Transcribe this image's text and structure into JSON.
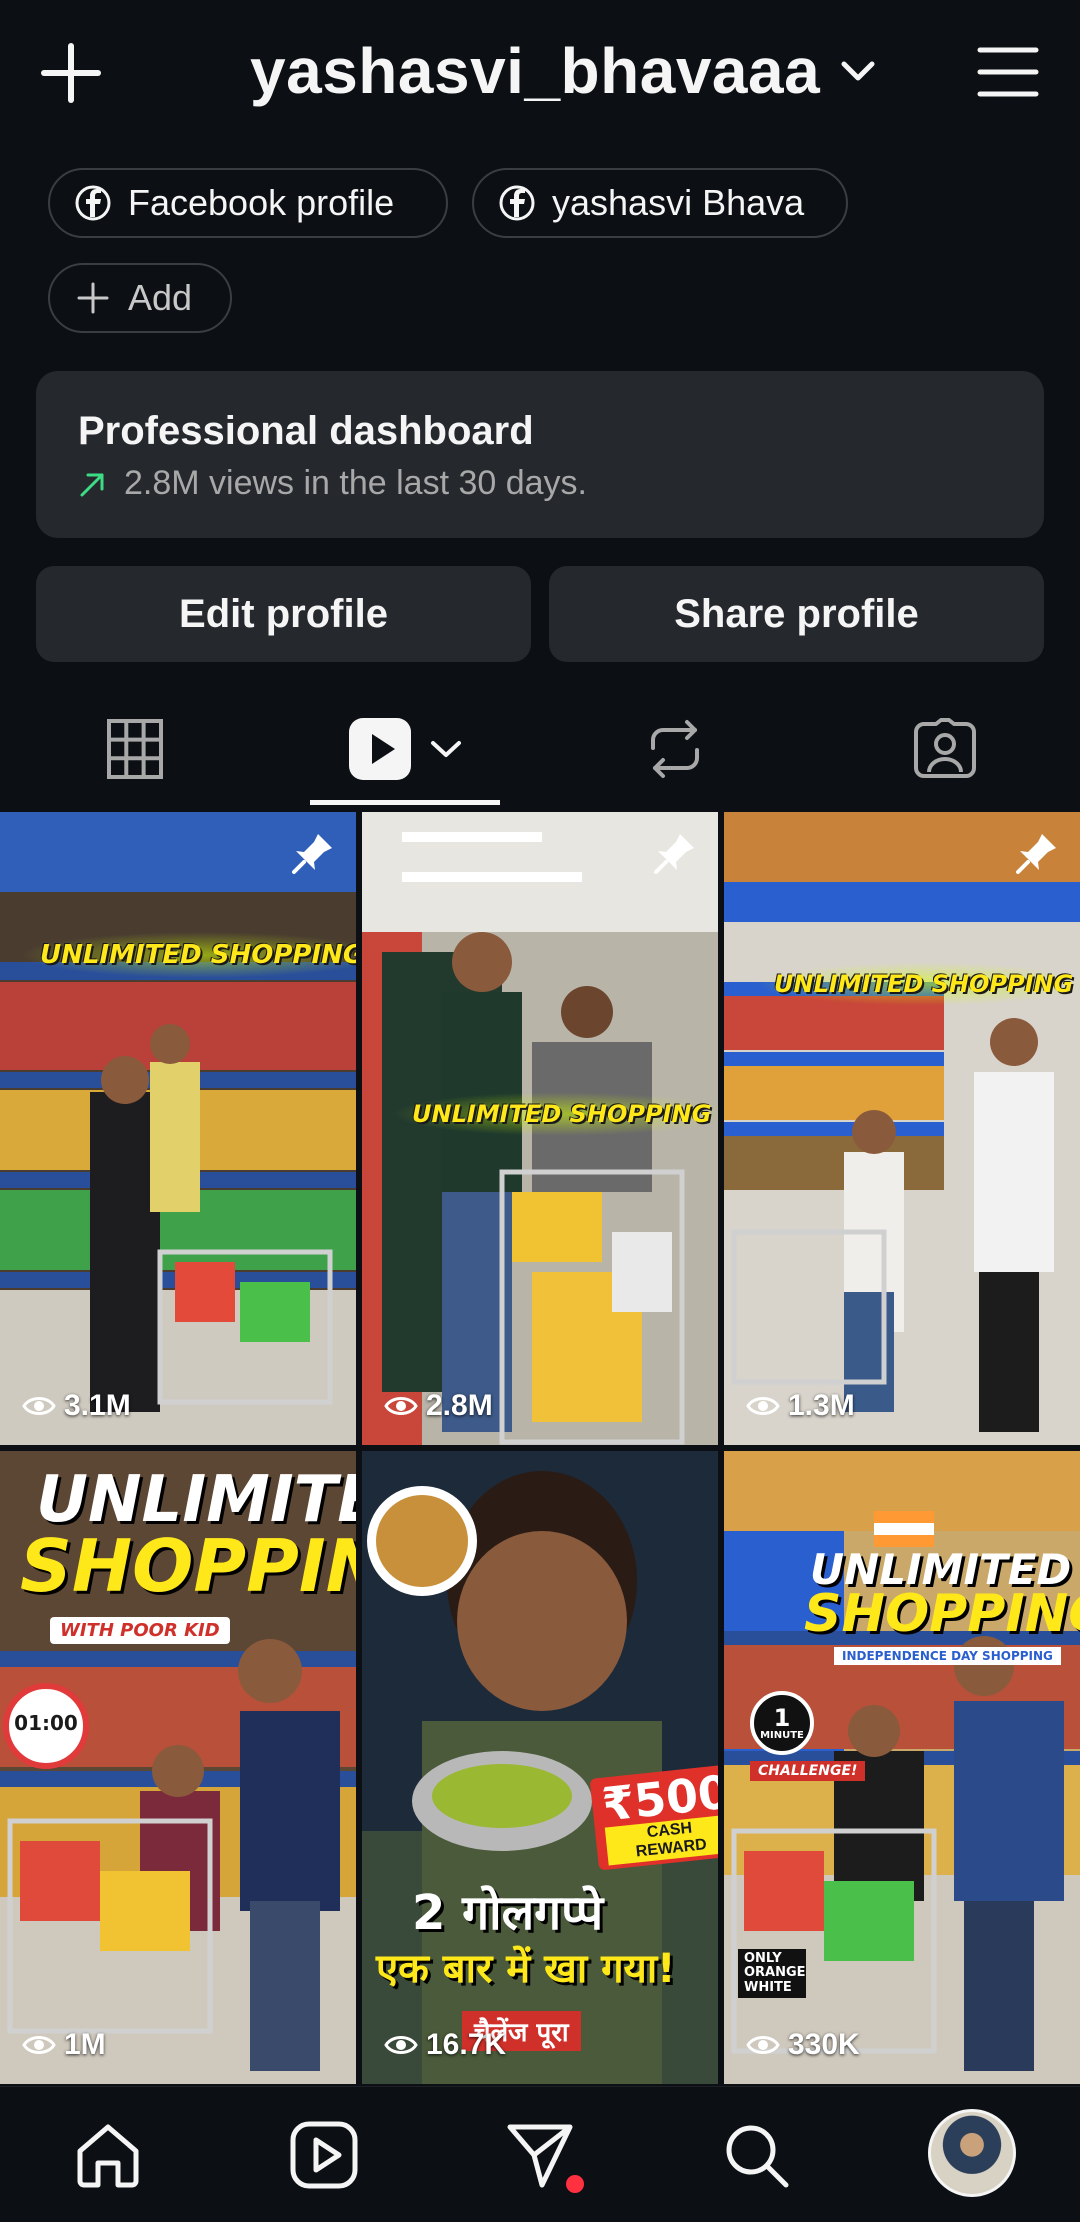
{
  "header": {
    "username": "yashasvi_bhavaaa"
  },
  "links": {
    "facebook_profile_label": "Facebook profile",
    "facebook_page_label": "yashasvi Bhava",
    "add_label": "Add"
  },
  "dashboard": {
    "title": "Professional dashboard",
    "subtitle": "2.8M views in the last 30 days.",
    "trend_color": "#3ddc84"
  },
  "actions": {
    "edit_profile": "Edit profile",
    "share_profile": "Share profile"
  },
  "tabs": [
    {
      "name": "grid",
      "icon": "grid-icon"
    },
    {
      "name": "reels",
      "icon": "reels-icon",
      "selected": true
    },
    {
      "name": "reposts",
      "icon": "repost-icon"
    },
    {
      "name": "tagged",
      "icon": "tagged-icon"
    }
  ],
  "reels": [
    {
      "views": "3.1M",
      "pinned": true,
      "overlay": "UNLIMITED SHOPPING"
    },
    {
      "views": "2.8M",
      "pinned": true,
      "overlay": "UNLIMITED SHOPPING"
    },
    {
      "views": "1.3M",
      "pinned": true,
      "overlay": "UNLIMITED SHOPPING"
    },
    {
      "views": "1M",
      "overlay_line1": "UNLIMITED",
      "overlay_line2": "SHOPPING",
      "tagline": "WITH POOR KID",
      "timer": "01:00"
    },
    {
      "views": "16.7K",
      "reward": "₹500",
      "reward_label": "CASH REWARD",
      "hindi_line1": "2 गोलगप्पे",
      "hindi_line2": "एक बार में खा गया!",
      "hindi_line3": "चैलेंज पूरा"
    },
    {
      "views": "330K",
      "overlay_line1": "UNLIMITED",
      "overlay_line2": "SHOPPING",
      "tagline": "INDEPENDENCE DAY SHOPPING",
      "timer_top": "1",
      "timer_bottom": "MINUTE",
      "challenge": "CHALLENGE!",
      "corner_note": "ONLY ORANGE WHITE"
    }
  ],
  "navbar": [
    {
      "name": "home",
      "icon": "home-icon"
    },
    {
      "name": "reels",
      "icon": "reels-icon"
    },
    {
      "name": "messages",
      "icon": "direct-message-icon",
      "badge": true
    },
    {
      "name": "search",
      "icon": "search-icon"
    },
    {
      "name": "profile",
      "icon": "avatar"
    }
  ]
}
